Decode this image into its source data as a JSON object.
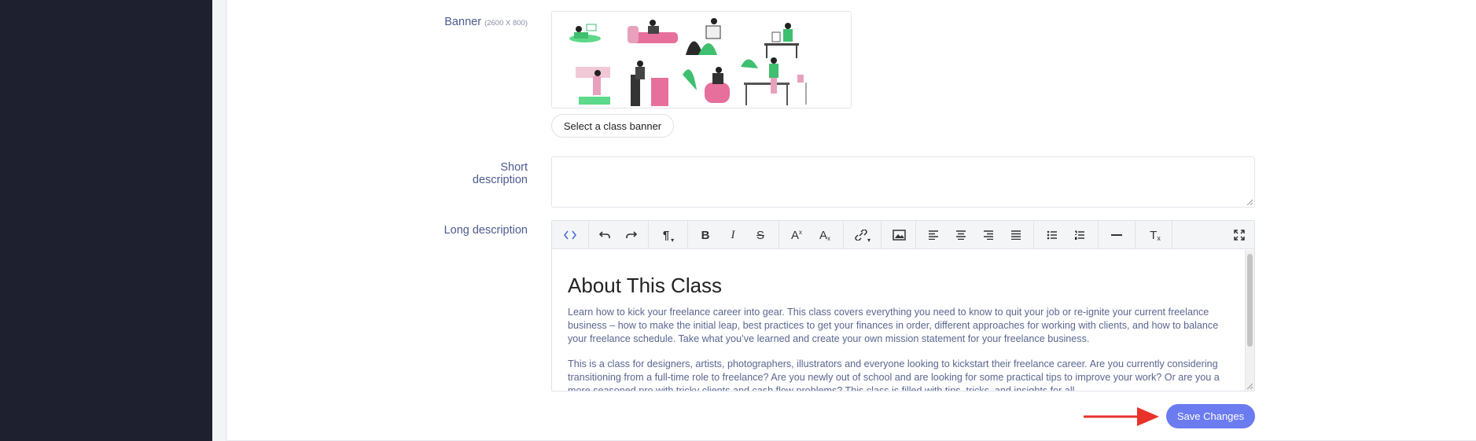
{
  "form": {
    "banner_label": "Banner",
    "banner_hint": "(2600 X 800)",
    "select_banner_button": "Select a class banner",
    "short_description_label": "Short description",
    "short_description_value": "",
    "long_description_label": "Long description"
  },
  "editor": {
    "toolbar": [
      {
        "name": "code-view-icon",
        "glyph": "<>"
      },
      {
        "name": "undo-icon",
        "glyph": "↶"
      },
      {
        "name": "redo-icon",
        "glyph": "↷"
      },
      {
        "name": "paragraph-format-icon",
        "glyph": "¶"
      },
      {
        "name": "bold-icon",
        "glyph": "B"
      },
      {
        "name": "italic-icon",
        "glyph": "I"
      },
      {
        "name": "strikethrough-icon",
        "glyph": "S"
      },
      {
        "name": "superscript-icon",
        "glyph": "A"
      },
      {
        "name": "subscript-icon",
        "glyph": "A"
      },
      {
        "name": "link-icon",
        "glyph": "🔗"
      },
      {
        "name": "image-icon",
        "glyph": "▣"
      },
      {
        "name": "align-left-icon",
        "glyph": "≡"
      },
      {
        "name": "align-center-icon",
        "glyph": "≡"
      },
      {
        "name": "align-right-icon",
        "glyph": "≡"
      },
      {
        "name": "align-justify-icon",
        "glyph": "≡"
      },
      {
        "name": "unordered-list-icon",
        "glyph": "•"
      },
      {
        "name": "ordered-list-icon",
        "glyph": "1"
      },
      {
        "name": "horizontal-rule-icon",
        "glyph": "—"
      },
      {
        "name": "clear-formatting-icon",
        "glyph": "T"
      },
      {
        "name": "fullscreen-icon",
        "glyph": "⤢"
      }
    ],
    "heading": "About This Class",
    "paragraph1": "Learn how to kick your freelance career into gear. This  class covers everything you need to know to quit your job or re-ignite your current freelance business – how to make the initial leap, best practices to get your finances in order, different approaches for working with clients, and how to balance your freelance schedule. Take what you’ve learned and create your own mission statement for your freelance business.",
    "paragraph2": "This is a class for designers, artists, photographers, illustrators and everyone looking to kickstart their freelance career. Are you currently considering transitioning from a full-time role to freelance? Are you newly out of school and are looking for some practical tips to improve your work? Or are you a more seasoned pro with tricky clients and cash flow problems? This class is filled with tips, tricks, and insights for all."
  },
  "actions": {
    "save_button": "Save Changes"
  },
  "colors": {
    "sidebar": "#1e2030",
    "accent": "#6b7bf0",
    "label": "#4d5b8f",
    "arrow": "#e8322a"
  }
}
